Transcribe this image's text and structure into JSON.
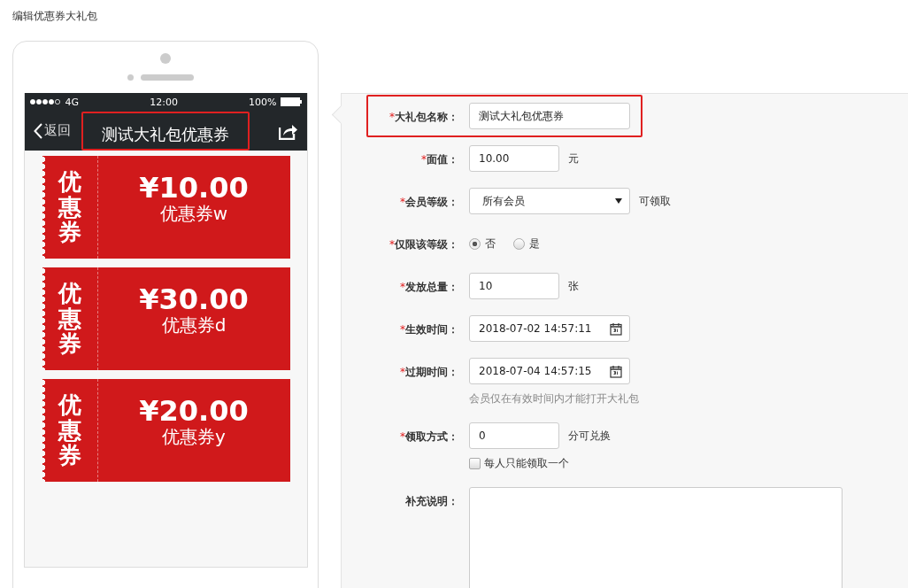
{
  "page_title": "编辑优惠券大礼包",
  "phone": {
    "status_bar": {
      "network": "4G",
      "time": "12:00",
      "battery": "100%"
    },
    "nav": {
      "back": "返回",
      "title": "测试大礼包优惠券",
      "highlighted": true
    },
    "coupons": [
      {
        "tag": "优惠券",
        "amount": "¥10.00",
        "name": "优惠券w"
      },
      {
        "tag": "优惠券",
        "amount": "¥30.00",
        "name": "优惠券d"
      },
      {
        "tag": "优惠券",
        "amount": "¥20.00",
        "name": "优惠券y"
      }
    ]
  },
  "form": {
    "required_mark": "*",
    "fields": [
      {
        "kind": "text",
        "label": "大礼包名称：",
        "required": true,
        "value": "测试大礼包优惠券",
        "wide": true,
        "highlighted": true
      },
      {
        "kind": "text",
        "label": "面值：",
        "required": true,
        "value": "10.00",
        "suffix": "元"
      },
      {
        "kind": "select",
        "label": "会员等级：",
        "required": true,
        "value": "所有会员",
        "suffix": "可领取"
      },
      {
        "kind": "radio",
        "label": "仅限该等级：",
        "required": true,
        "options": [
          {
            "label": "否",
            "selected": true
          },
          {
            "label": "是",
            "selected": false
          }
        ]
      },
      {
        "kind": "text",
        "label": "发放总量：",
        "required": true,
        "value": "10",
        "suffix": "张"
      },
      {
        "kind": "date",
        "label": "生效时间：",
        "required": true,
        "value": "2018-07-02 14:57:11"
      },
      {
        "kind": "date",
        "label": "过期时间：",
        "required": true,
        "value": "2018-07-04 14:57:15",
        "hint": "会员仅在有效时间内才能打开大礼包"
      },
      {
        "kind": "text",
        "label": "领取方式：",
        "required": true,
        "value": "0",
        "suffix": "分可兑换",
        "checkbox": {
          "label": "每人只能领取一个",
          "checked": false
        }
      },
      {
        "kind": "textarea",
        "label": "补充说明：",
        "required": false
      }
    ]
  }
}
